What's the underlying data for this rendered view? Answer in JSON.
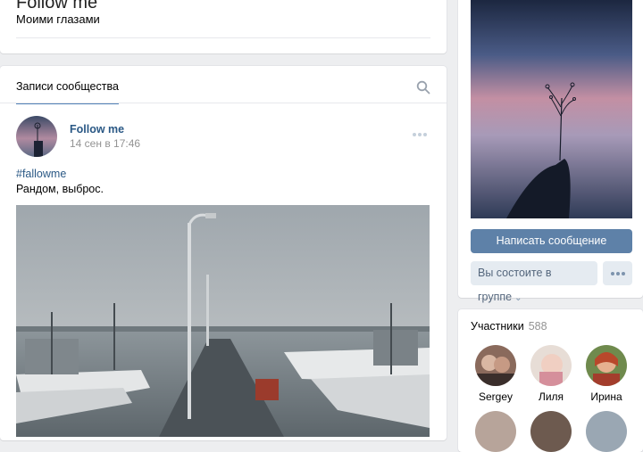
{
  "header": {
    "title": "Follow me",
    "status": "Моими глазами"
  },
  "posts": {
    "tab_label": "Записи сообщества",
    "icons": {
      "search": "search-icon",
      "more": "more-dots-icon"
    },
    "post": {
      "author": "Follow me",
      "date": "14 сен в 17:46",
      "hashtag": "#fallowme",
      "text": "Рандом, выброс."
    }
  },
  "sidebar": {
    "send_message_label": "Написать сообщение",
    "member_status_label": "Вы состоите в группе",
    "member_status_icon": "chevron-down-icon",
    "more_icon": "more-dots-icon"
  },
  "members": {
    "title": "Участники",
    "count": "588",
    "list": [
      {
        "name": "Sergey"
      },
      {
        "name": "Лиля"
      },
      {
        "name": "Ирина"
      }
    ]
  },
  "colors": {
    "accent": "#5181b8",
    "link": "#2a5885",
    "button_primary": "#5e81a8",
    "button_secondary": "#e5ebf1",
    "page_background": "#edeef0"
  }
}
